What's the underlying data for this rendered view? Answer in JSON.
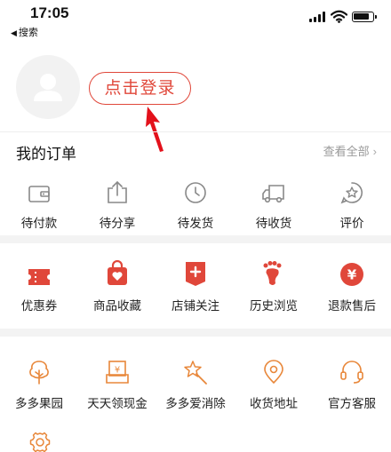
{
  "status_bar": {
    "time": "17:05",
    "back_label": "搜索"
  },
  "profile": {
    "login_label": "点击登录"
  },
  "orders": {
    "title": "我的订单",
    "view_all": "查看全部",
    "items": [
      {
        "label": "待付款",
        "icon": "wallet-icon"
      },
      {
        "label": "待分享",
        "icon": "share-icon"
      },
      {
        "label": "待发货",
        "icon": "clock-icon"
      },
      {
        "label": "待收货",
        "icon": "truck-icon"
      },
      {
        "label": "评价",
        "icon": "review-icon"
      }
    ]
  },
  "favorites": {
    "items": [
      {
        "label": "优惠券",
        "icon": "coupon-icon"
      },
      {
        "label": "商品收藏",
        "icon": "bag-heart-icon"
      },
      {
        "label": "店铺关注",
        "icon": "store-plus-icon"
      },
      {
        "label": "历史浏览",
        "icon": "footprint-icon"
      },
      {
        "label": "退款售后",
        "icon": "yuan-icon"
      }
    ]
  },
  "tools": {
    "items": [
      {
        "label": "多多果园",
        "icon": "tree-icon"
      },
      {
        "label": "天天领现金",
        "icon": "cash-icon"
      },
      {
        "label": "多多爱消除",
        "icon": "wand-icon"
      },
      {
        "label": "收货地址",
        "icon": "location-icon"
      },
      {
        "label": "官方客服",
        "icon": "headset-icon"
      }
    ],
    "extra_icon": "settings-icon"
  },
  "colors": {
    "accent": "#e0473a",
    "icon_gray": "#888888",
    "icon_orange": "#e8873a"
  }
}
